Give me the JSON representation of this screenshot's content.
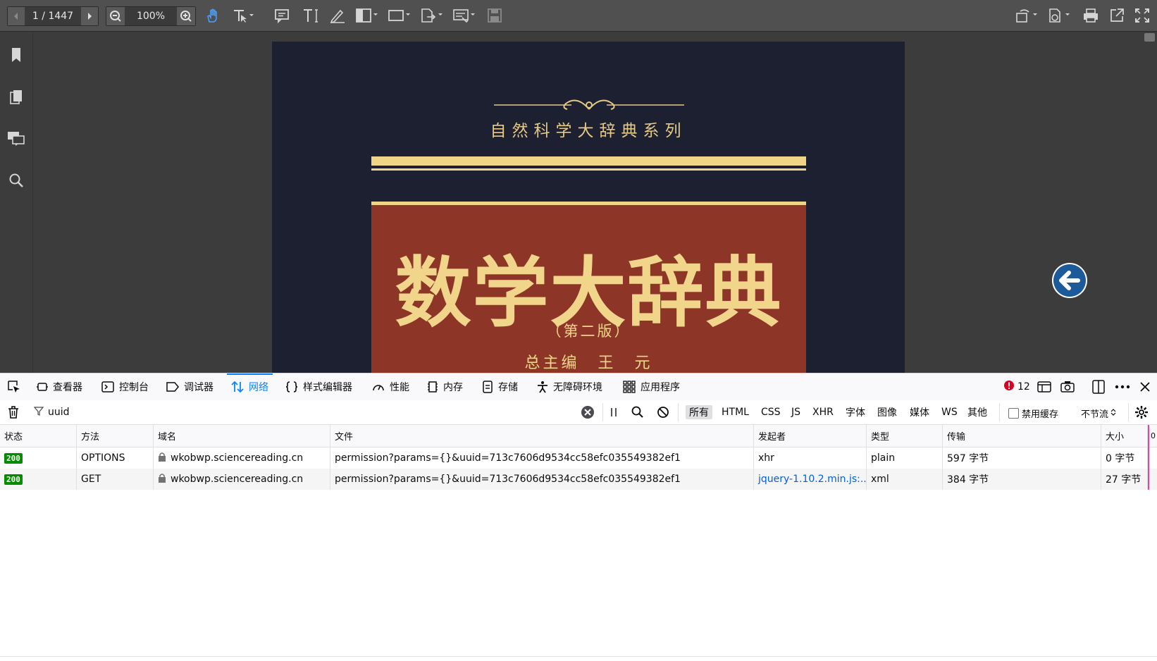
{
  "viewer": {
    "page_indicator": "1 / 1447",
    "zoom": "100%",
    "toolbar_icons": [
      "prev-page-icon",
      "next-page-icon",
      "zoom-out-icon",
      "zoom-in-icon",
      "hand-tool-icon",
      "select-text-icon",
      "comment-icon",
      "text-tool-icon",
      "highlight-pen-icon",
      "column-layout-icon",
      "shape-icon",
      "export-icon",
      "form-icon",
      "save-icon",
      "rotate-icon",
      "stamp-icon",
      "print-icon",
      "open-external-icon",
      "fullscreen-icon"
    ],
    "sidebar_icons": [
      "bookmark-icon",
      "pages-icon",
      "comments-icon",
      "search-icon"
    ]
  },
  "cover": {
    "series": "自然科学大辞典系列",
    "title": "数学大辞典",
    "edition": "（第二版）",
    "editor": "总主编　王　元",
    "colors": {
      "background": "#1d2030",
      "gold": "#f0d488",
      "panel": "#8d3627"
    }
  },
  "devtools": {
    "tabs": [
      {
        "label": "查看器",
        "icon": "inspector-icon"
      },
      {
        "label": "控制台",
        "icon": "console-icon"
      },
      {
        "label": "调试器",
        "icon": "debugger-icon"
      },
      {
        "label": "网络",
        "icon": "network-icon",
        "active": true
      },
      {
        "label": "样式编辑器",
        "icon": "style-editor-icon"
      },
      {
        "label": "性能",
        "icon": "performance-icon"
      },
      {
        "label": "内存",
        "icon": "memory-icon"
      },
      {
        "label": "存储",
        "icon": "storage-icon"
      },
      {
        "label": "无障碍环境",
        "icon": "accessibility-icon"
      },
      {
        "label": "应用程序",
        "icon": "application-icon"
      }
    ],
    "error_count": "12",
    "filter": {
      "value": "uuid"
    },
    "type_filters": [
      "所有",
      "HTML",
      "CSS",
      "JS",
      "XHR",
      "字体",
      "图像",
      "媒体",
      "WS",
      "其他"
    ],
    "disable_cache": "禁用缓存",
    "throttle": "不节流",
    "columns": [
      "状态",
      "方法",
      "域名",
      "文件",
      "发起者",
      "类型",
      "传输",
      "大小"
    ],
    "overflow_col": "0",
    "rows": [
      {
        "status": "200",
        "method": "OPTIONS",
        "domain": "wkobwp.sciencereading.cn",
        "file": "permission?params={}&uuid=713c7606d9534cc58efc035549382ef1",
        "initiator": "xhr",
        "type": "plain",
        "transfer": "597 字节",
        "size": "0 字节"
      },
      {
        "status": "200",
        "method": "GET",
        "domain": "wkobwp.sciencereading.cn",
        "file": "permission?params={}&uuid=713c7606d9534cc58efc035549382ef1",
        "initiator": "jquery-1.10.2.min.js:...",
        "type": "xml",
        "transfer": "384 字节",
        "size": "27 字节"
      }
    ]
  }
}
